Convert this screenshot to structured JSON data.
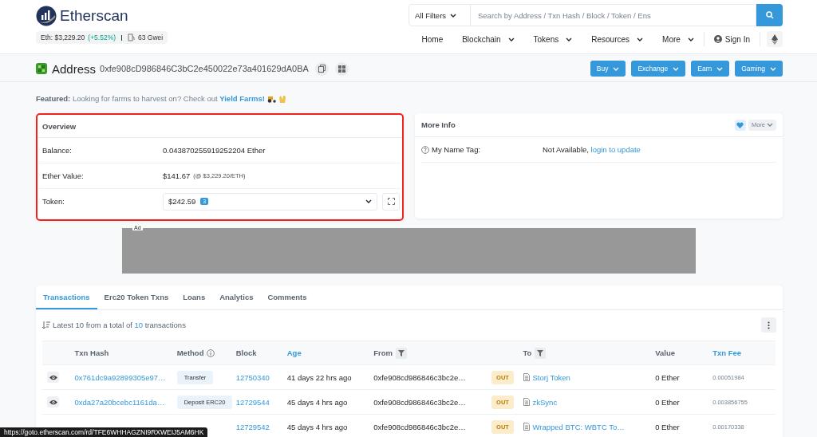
{
  "header": {
    "logo_text": "Etherscan",
    "eth_price": {
      "label": "Eth: $3,229.20",
      "change": "(+5.52%)",
      "gas": "63 Gwei"
    },
    "search": {
      "filter": "All Filters",
      "placeholder": "Search by Address / Txn Hash / Block / Token / Ens"
    },
    "nav": [
      {
        "label": "Home",
        "dropdown": false
      },
      {
        "label": "Blockchain",
        "dropdown": true
      },
      {
        "label": "Tokens",
        "dropdown": true
      },
      {
        "label": "Resources",
        "dropdown": true
      },
      {
        "label": "More",
        "dropdown": true
      }
    ],
    "sign_in": "Sign In"
  },
  "address": {
    "label": "Address",
    "hash": "0xfe908cD986846C3bC2e450022e73a401629dA0BA",
    "buttons": [
      "Buy",
      "Exchange",
      "Earn",
      "Gaming"
    ]
  },
  "featured": {
    "label": "Featured:",
    "text": "Looking for farms to harvest on? Check out",
    "link": "Yield Farms!"
  },
  "overview": {
    "title": "Overview",
    "highlighted": true,
    "rows": [
      {
        "kind": "text",
        "label": "Balance:",
        "value": "0.043870255919252204 Ether"
      },
      {
        "kind": "price",
        "label": "Ether Value:",
        "value": "$141.67",
        "note": "(@ $3,229.20/ETH)"
      },
      {
        "kind": "select",
        "label": "Token:",
        "value": "$242.59",
        "count": "3"
      }
    ]
  },
  "more_info": {
    "title": "More Info",
    "button": "More",
    "rows": [
      {
        "label": "My Name Tag:",
        "value": "Not Available,",
        "link": "login to update"
      }
    ]
  },
  "ad": {
    "label": "Ad"
  },
  "tabs": [
    {
      "label": "Transactions",
      "selected": true
    },
    {
      "label": "Erc20 Token Txns",
      "selected": false
    },
    {
      "label": "Loans",
      "selected": false
    },
    {
      "label": "Analytics",
      "selected": false
    },
    {
      "label": "Comments",
      "selected": false
    }
  ],
  "summary": {
    "text": "Latest 10 from a total of",
    "count": "10",
    "suffix": "transactions"
  },
  "table": {
    "columns": [
      {
        "label": "Txn Hash",
        "kind": "plain"
      },
      {
        "label": "Method",
        "kind": "info"
      },
      {
        "label": "Block",
        "kind": "plain"
      },
      {
        "label": "Age",
        "kind": "sort"
      },
      {
        "label": "From",
        "kind": "filter"
      },
      {
        "label": "To",
        "kind": "filter"
      },
      {
        "label": "Value",
        "kind": "plain"
      },
      {
        "label": "Txn Fee",
        "kind": "sort"
      }
    ],
    "rows": [
      {
        "hash": "0x761dc9a92899305e97…",
        "method": "Transfer",
        "block": "12750340",
        "age": "41 days 22 hrs ago",
        "from": "0xfe908cd986846c3bc2e…",
        "direction": "OUT",
        "to": "Storj Token",
        "value": "0 Ether",
        "fee": "0.00051984"
      },
      {
        "hash": "0xda27a20bcebc1161da…",
        "method": "Deposit ERC20",
        "block": "12729544",
        "age": "45 days 4 hrs ago",
        "from": "0xfe908cd986846c3bc2e…",
        "direction": "OUT",
        "to": "zkSync",
        "value": "0 Ether",
        "fee": "0.003856755"
      },
      {
        "block": "12729542",
        "age": "45 days 4 hrs ago",
        "from": "0xfe908cd986846c3bc2e…",
        "direction": "OUT",
        "to": "Wrapped BTC: WBTC To…",
        "value": "0 Ether",
        "fee": "0.00170338"
      }
    ]
  },
  "status_url": "https://goto.etherscan.com/rd/TFE6WHHAGZNI9RXWEIJ5AM6HK"
}
